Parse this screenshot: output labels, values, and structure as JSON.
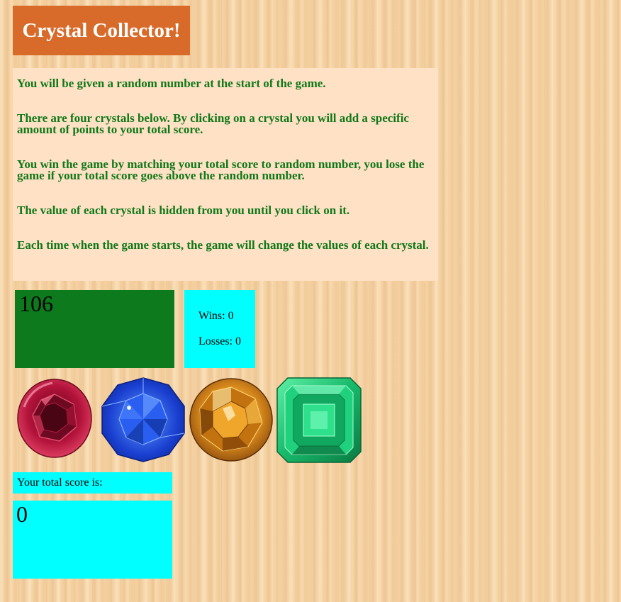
{
  "header": {
    "title": "Crystal Collector!"
  },
  "instructions": [
    "You will be given a random number at the start of the game.",
    "There are four crystals below. By clicking on a crystal you will add a specific amount of points to your total score.",
    "You win the game by matching your total score to random number, you lose the game if your total score goes above the random number.",
    "The value of each crystal is hidden from you until you click on it.",
    "Each time when the game starts, the game will change the values of each crystal."
  ],
  "game": {
    "target_number": "106",
    "wins_text": "Wins: 0",
    "losses_text": "Losses: 0",
    "score_label": "Your total score is:",
    "total_score": "0"
  },
  "crystals": [
    {
      "name": "ruby-crystal",
      "color": "#c0173c"
    },
    {
      "name": "sapphire-crystal",
      "color": "#1a4fd8"
    },
    {
      "name": "topaz-crystal",
      "color": "#d8891c"
    },
    {
      "name": "emerald-crystal",
      "color": "#17b86a"
    }
  ]
}
